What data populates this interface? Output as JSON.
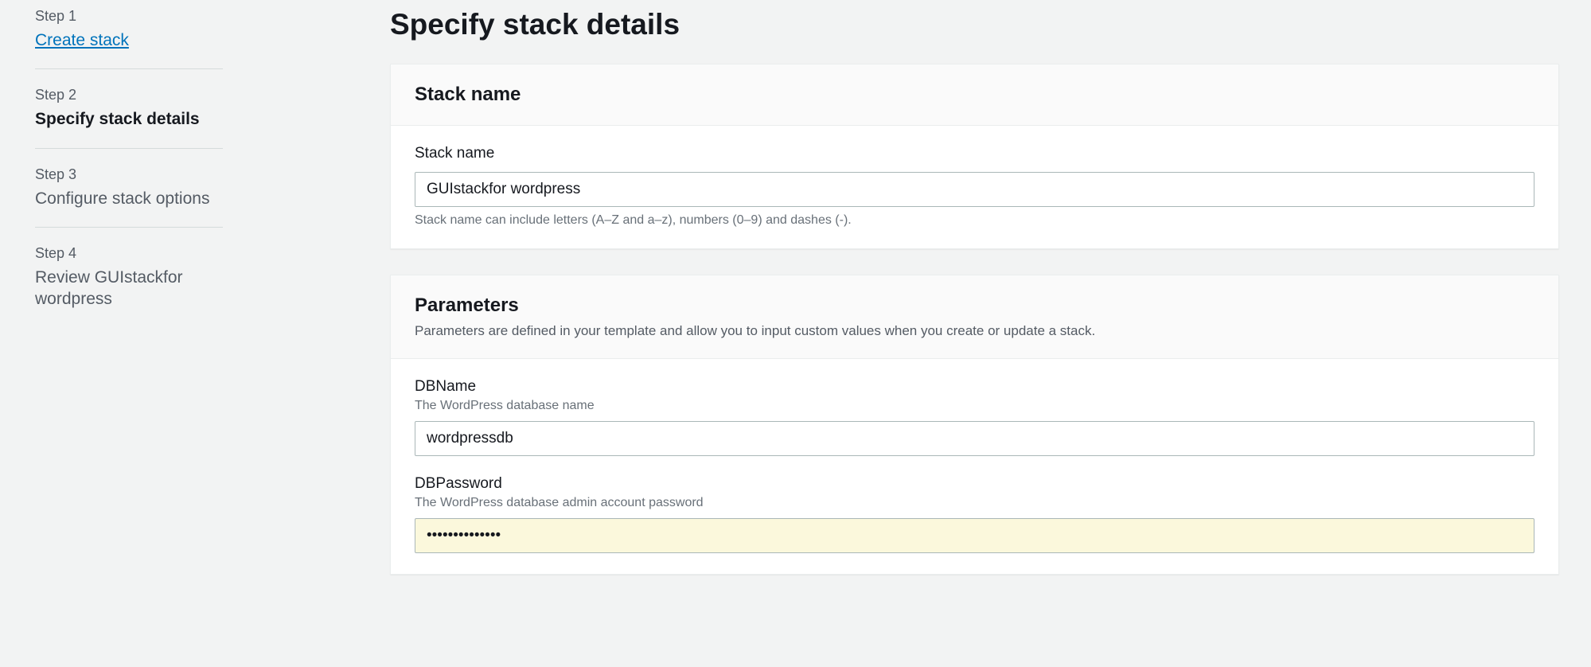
{
  "sidebar": {
    "steps": [
      {
        "num": "Step 1",
        "title": "Create stack"
      },
      {
        "num": "Step 2",
        "title": "Specify stack details"
      },
      {
        "num": "Step 3",
        "title": "Configure stack options"
      },
      {
        "num": "Step 4",
        "title": "Review GUIstackfor wordpress"
      }
    ]
  },
  "page": {
    "title": "Specify stack details"
  },
  "stack_name_panel": {
    "header": "Stack name",
    "field_label": "Stack name",
    "value": "GUIstackfor wordpress",
    "hint": "Stack name can include letters (A–Z and a–z), numbers (0–9) and dashes (-)."
  },
  "parameters_panel": {
    "header": "Parameters",
    "subtext": "Parameters are defined in your template and allow you to input custom values when you create or update a stack.",
    "fields": {
      "dbname": {
        "label": "DBName",
        "desc": "The WordPress database name",
        "value": "wordpressdb"
      },
      "dbpassword": {
        "label": "DBPassword",
        "desc": "The WordPress database admin account password",
        "value": "••••••••••••••"
      }
    }
  }
}
